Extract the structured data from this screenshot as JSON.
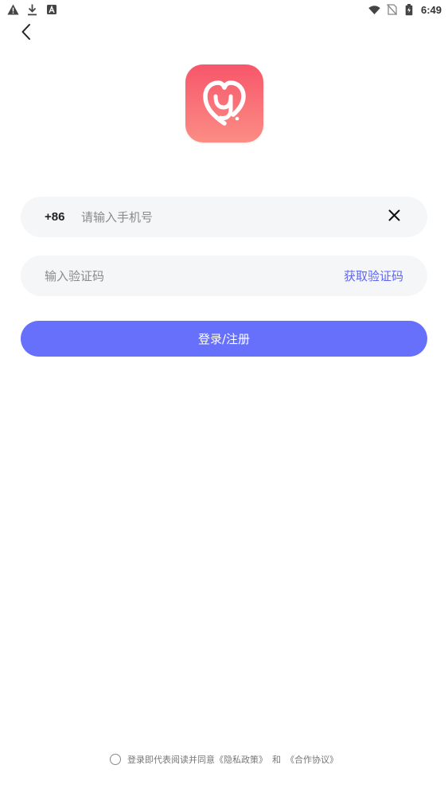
{
  "status_bar": {
    "time": "6:49",
    "left_icons": [
      "warning-icon",
      "download-icon",
      "a-badge-icon"
    ],
    "right_icons": [
      "wifi-icon",
      "no-sim-icon",
      "battery-icon"
    ]
  },
  "header": {
    "back_icon": "chevron-left-icon"
  },
  "logo": {
    "icon": "heart-y-logo",
    "gradient_top": "#f7566a",
    "gradient_bottom": "#fb8d85"
  },
  "phone_field": {
    "country_code": "+86",
    "value": "",
    "placeholder": "请输入手机号",
    "clear_icon": "close-icon"
  },
  "code_field": {
    "value": "",
    "placeholder": "输入验证码",
    "get_code_label": "获取验证码"
  },
  "login_button": {
    "label": "登录/注册",
    "color": "#6670fb"
  },
  "agreement": {
    "prefix": "登录即代表阅读并同意",
    "privacy_link": "《隐私政策》",
    "conjunction": "和",
    "terms_link": "《合作协议》",
    "checked": false
  },
  "colors": {
    "accent": "#6670fb",
    "link": "#5f67ef",
    "field_bg": "#f5f6f8"
  }
}
